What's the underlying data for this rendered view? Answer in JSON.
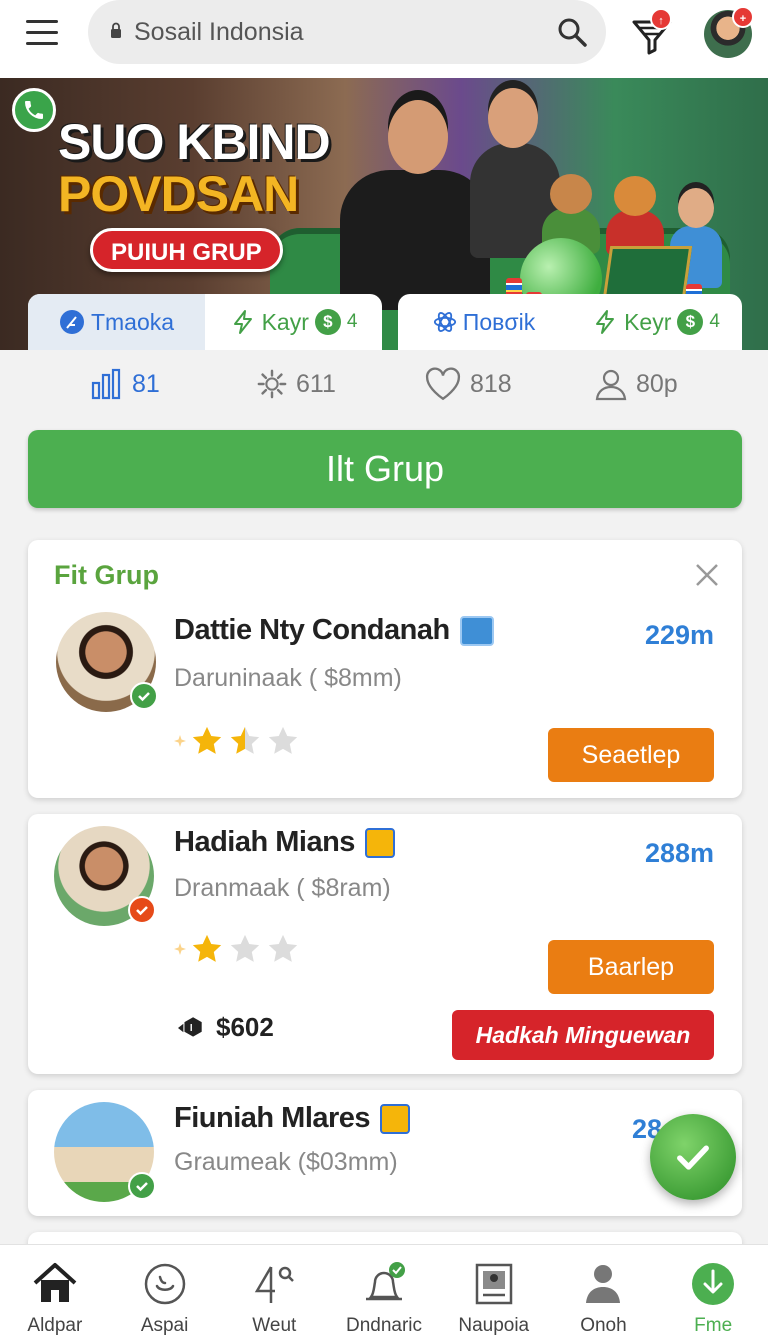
{
  "header": {
    "search_value": "Sosail Indonsia",
    "filter_badge": "↑",
    "avatar_badge": "+"
  },
  "hero": {
    "title_line1": "SUO KBIND",
    "title_line2": "POVDSAN",
    "tag": "PUIUH GRUP",
    "tabs_left": [
      {
        "label": "Tmaoka",
        "icon": "feather-icon"
      },
      {
        "label": "Kayr",
        "icon": "bolt-icon",
        "coin": "$",
        "coin_count": "4"
      }
    ],
    "tabs_right": [
      {
        "label": "Πoвσik",
        "icon": "atom-icon"
      },
      {
        "label": "Keyr",
        "icon": "bolt-icon",
        "coin": "$",
        "coin_count": "4"
      }
    ]
  },
  "stats": [
    {
      "icon": "bar-chart-icon",
      "value": "81"
    },
    {
      "icon": "gear-icon",
      "value": "611"
    },
    {
      "icon": "heart-icon",
      "value": "818"
    },
    {
      "icon": "user-icon",
      "value": "80p"
    }
  ],
  "main_button": "Ilt Grup",
  "cards": [
    {
      "header": "Fit Grup",
      "name": "Dattie Nty Condanah",
      "subtitle": "Daruninaak ( $8mm)",
      "distance": "229m",
      "rating": 1.5,
      "action": "Seaetlep"
    },
    {
      "name": "Hadiah Mians",
      "subtitle": "Dranmaak ( $8ram)",
      "distance": "288m",
      "rating": 1,
      "action": "Baarlep",
      "price": "$602",
      "promo": "Hadkah Minguewan"
    },
    {
      "name": "Fiuniah Mlares",
      "subtitle": "Graumeak ($03mm)",
      "distance": "28"
    }
  ],
  "nav": [
    {
      "label": "Aldpar",
      "icon": "home-icon"
    },
    {
      "label": "Aspai",
      "icon": "smile-circle-icon"
    },
    {
      "label": "Weut",
      "icon": "four-search-icon"
    },
    {
      "label": "Dndnaric",
      "icon": "bell-check-icon"
    },
    {
      "label": "Naupoia",
      "icon": "photo-frame-icon"
    },
    {
      "label": "Onoh",
      "icon": "person-icon"
    },
    {
      "label": "Fme",
      "icon": "download-circle-icon"
    }
  ],
  "colors": {
    "primary_green": "#4caf50",
    "accent_blue": "#2f7fd6",
    "orange": "#ea7d12",
    "red": "#d6242a"
  }
}
